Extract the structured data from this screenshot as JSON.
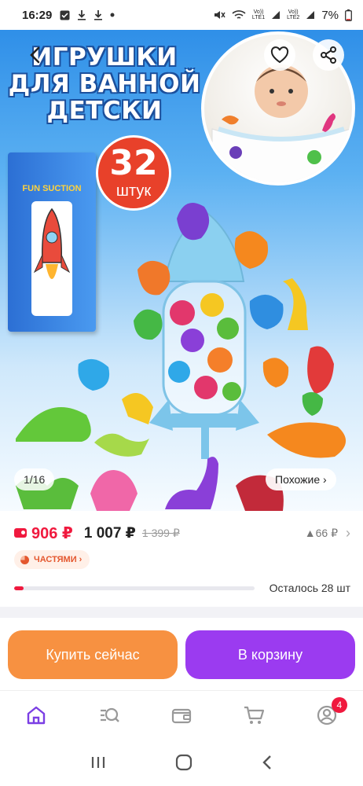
{
  "status_bar": {
    "time": "16:29",
    "battery": "7%",
    "sim1": "Vo))\nLTE1",
    "sim2": "Vo))\nLTE2"
  },
  "product": {
    "image_title": "ИГРУШКИ ДЛЯ ВАННОЙ ДЕТСКИ",
    "badge_number": "32",
    "badge_unit": "штук",
    "box_brand": "FUN SUCTION",
    "image_counter": "1/16",
    "similar_label": "Похожие ›"
  },
  "pricing": {
    "wallet_price": "906 ₽",
    "price": "1 007 ₽",
    "old_price": "1 399 ₽",
    "bonus": "▲66 ₽",
    "installments_label": "ЧАСТЯМИ ›",
    "stock_label": "Осталось 28 шт",
    "stock_fraction": 0.04
  },
  "actions": {
    "buy_now": "Купить сейчас",
    "add_to_cart": "В корзину"
  },
  "tabbar": {
    "items": [
      "home-icon",
      "catalog-search-icon",
      "wallet-icon",
      "cart-icon",
      "profile-icon"
    ],
    "profile_badge": "4"
  },
  "colors": {
    "accent_red": "#f0193e",
    "buy_orange": "#f79141",
    "cart_purple": "#9b3bf0",
    "tab_active": "#7b3fe4"
  }
}
